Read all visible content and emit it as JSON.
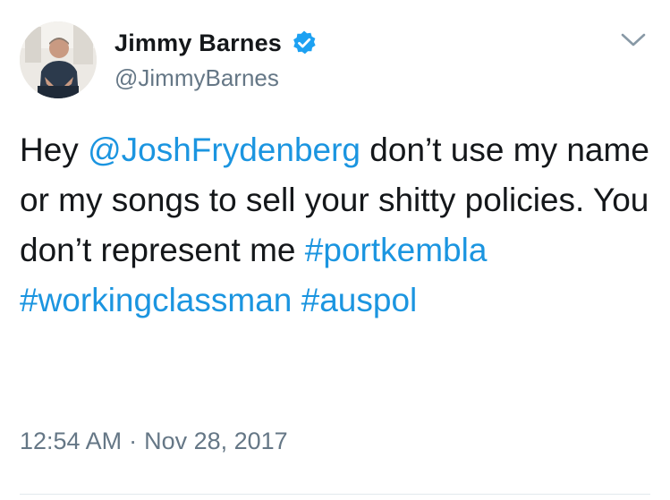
{
  "author": {
    "display_name": "Jimmy Barnes",
    "handle": "@JimmyBarnes",
    "verified_icon": "verified-badge-icon",
    "avatar": "profile-photo"
  },
  "menu": {
    "icon": "chevron-down-icon"
  },
  "tweet": {
    "segments": [
      {
        "text": "Hey ",
        "type": "text"
      },
      {
        "text": "@JoshFrydenberg",
        "type": "mention"
      },
      {
        "text": " don’t use my name or my songs to sell your shitty policies. You don’t represent me ",
        "type": "text"
      },
      {
        "text": "#portkembla",
        "type": "hashtag"
      },
      {
        "text": " ",
        "type": "text"
      },
      {
        "text": "#workingclassman",
        "type": "hashtag"
      },
      {
        "text": " ",
        "type": "text"
      },
      {
        "text": "#auspol",
        "type": "hashtag"
      }
    ]
  },
  "timestamp": {
    "time": "12:54 AM",
    "separator": "·",
    "date": "Nov 28, 2017"
  },
  "colors": {
    "link": "#1b95e0",
    "text": "#14171a",
    "secondary": "#657786",
    "verified": "#1da1f2"
  }
}
